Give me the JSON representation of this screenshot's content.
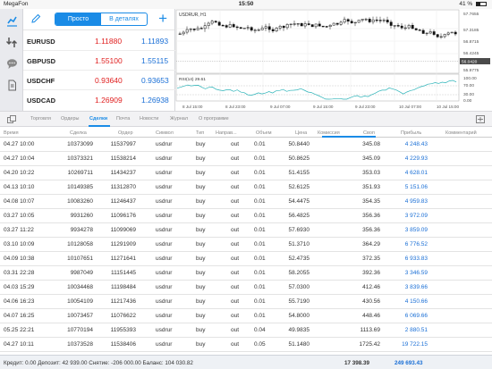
{
  "statusbar": {
    "carrier": "MegaFon",
    "time": "15:50",
    "battery": "41 %",
    "battery_level": 0.41
  },
  "quotes": {
    "segments": [
      "Просто",
      "В деталях"
    ],
    "active_segment": 0,
    "rows": [
      {
        "symbol": "EURUSD",
        "bid": "1.11880",
        "ask": "1.11893"
      },
      {
        "symbol": "GBPUSD",
        "bid": "1.55100",
        "ask": "1.55115"
      },
      {
        "symbol": "USDCHF",
        "bid": "0.93640",
        "ask": "0.93653"
      },
      {
        "symbol": "USDCAD",
        "bid": "1.26909",
        "ask": "1.26938"
      }
    ]
  },
  "chart": {
    "symbol_label": "USDRUR, H1",
    "price_ticks": [
      "57.7655",
      "57.3185",
      "56.8715",
      "56.4245",
      "55.9775"
    ],
    "current_price": "56.0420",
    "rsi_label": "RSI(14) 29.61",
    "rsi_ticks": [
      "100.00",
      "70.00",
      "30.00",
      "0.00"
    ],
    "time_ticks": [
      "8 Jul 15:00",
      "8 Jul 23:00",
      "9 Jul 07:00",
      "9 Jul 15:00",
      "9 Jul 23:00",
      "10 Jul 07:00",
      "10 Jul 15:00"
    ]
  },
  "tabs": [
    {
      "label": "Торговля",
      "active": false
    },
    {
      "label": "Ордеры",
      "active": false
    },
    {
      "label": "Сделки",
      "active": true
    },
    {
      "label": "Почта",
      "active": false
    },
    {
      "label": "Новости",
      "active": false
    },
    {
      "label": "Журнал",
      "active": false
    },
    {
      "label": "О программе",
      "active": false
    }
  ],
  "table": {
    "columns": [
      "Время",
      "Сделка",
      "Ордер",
      "Символ",
      "Тип",
      "Направ...",
      "Объем",
      "Цена",
      "Комиссия",
      "Своп",
      "Прибыль",
      "Комментарий"
    ],
    "rows": [
      [
        "04.27 10:00",
        "10373099",
        "11537997",
        "usdrur",
        "buy",
        "out",
        "0.01",
        "50.8440",
        "",
        "345.08",
        "4 248.43",
        ""
      ],
      [
        "04.27 10:04",
        "10373321",
        "11538214",
        "usdrur",
        "buy",
        "out",
        "0.01",
        "50.8625",
        "",
        "345.09",
        "4 229.93",
        ""
      ],
      [
        "04.20 10:22",
        "10269711",
        "11434237",
        "usdrur",
        "buy",
        "out",
        "0.01",
        "51.4155",
        "",
        "353.03",
        "4 628.01",
        ""
      ],
      [
        "04.13 10:10",
        "10149385",
        "11312870",
        "usdrur",
        "buy",
        "out",
        "0.01",
        "52.6125",
        "",
        "351.93",
        "5 151.06",
        ""
      ],
      [
        "04.08 10:07",
        "10083260",
        "11246437",
        "usdrur",
        "buy",
        "out",
        "0.01",
        "54.4475",
        "",
        "354.35",
        "4 959.83",
        ""
      ],
      [
        "03.27 10:05",
        "9931260",
        "11096176",
        "usdrur",
        "buy",
        "out",
        "0.01",
        "56.4825",
        "",
        "356.36",
        "3 972.09",
        ""
      ],
      [
        "03.27 11:22",
        "9934278",
        "11099069",
        "usdrur",
        "buy",
        "out",
        "0.01",
        "57.6930",
        "",
        "356.36",
        "3 859.09",
        ""
      ],
      [
        "03.10 10:09",
        "10128058",
        "11291909",
        "usdrur",
        "buy",
        "out",
        "0.01",
        "51.3710",
        "",
        "364.29",
        "6 776.52",
        ""
      ],
      [
        "04.09 10:38",
        "10107651",
        "11271641",
        "usdrur",
        "buy",
        "out",
        "0.01",
        "52.4735",
        "",
        "372.35",
        "6 933.83",
        ""
      ],
      [
        "03.31 22:28",
        "9987049",
        "11151445",
        "usdrur",
        "buy",
        "out",
        "0.01",
        "58.2055",
        "",
        "392.36",
        "3 346.59",
        ""
      ],
      [
        "04.03 15:29",
        "10034468",
        "11198484",
        "usdrur",
        "buy",
        "out",
        "0.01",
        "57.0300",
        "",
        "412.46",
        "3 839.66",
        ""
      ],
      [
        "04.06 16:23",
        "10054109",
        "11217436",
        "usdrur",
        "buy",
        "out",
        "0.01",
        "55.7190",
        "",
        "430.56",
        "4 150.66",
        ""
      ],
      [
        "04.07 16:25",
        "10073457",
        "11076622",
        "usdrur",
        "buy",
        "out",
        "0.01",
        "54.8000",
        "",
        "448.46",
        "6 069.66",
        ""
      ],
      [
        "05.25 22:21",
        "10770194",
        "11955393",
        "usdrur",
        "buy",
        "out",
        "0.04",
        "49.9835",
        "",
        "1113.69",
        "2 880.51",
        ""
      ],
      [
        "04.27 10:11",
        "10373528",
        "11538406",
        "usdrur",
        "buy",
        "out",
        "0.05",
        "51.1480",
        "",
        "1725.42",
        "19 722.15",
        ""
      ]
    ]
  },
  "footer": {
    "account": "Кредит: 0.00 Депозит: 42 939.00 Снятие: -206 000.00 Баланс: 104 030.82",
    "total_swap": "17 398.39",
    "total_profit": "249 693.43"
  }
}
